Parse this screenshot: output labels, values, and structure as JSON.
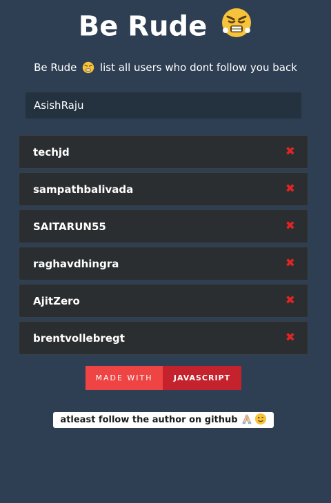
{
  "header": {
    "title": "Be Rude",
    "title_icon": "angry-face-icon"
  },
  "subtitle": {
    "before": "Be Rude",
    "icon": "angry-face-icon",
    "after": "list all users who dont follow you back"
  },
  "search": {
    "value": "AsishRaju"
  },
  "users": [
    {
      "name": "techjd"
    },
    {
      "name": "sampathbalivada"
    },
    {
      "name": "SAITARUN55"
    },
    {
      "name": "raghavdhingra"
    },
    {
      "name": "AjitZero"
    },
    {
      "name": "brentvollebregt"
    }
  ],
  "remove_icon": "cross-icon",
  "badge": {
    "left": "MADE WITH",
    "right": "JAVASCRIPT"
  },
  "footer": {
    "link_text": "atleast follow the author on github",
    "icons": [
      "folded-hands-icon",
      "winking-face-icon"
    ]
  },
  "colors": {
    "background": "#2e3f53",
    "remove": "#e02424",
    "badge_left": "#ef4444",
    "badge_right": "#c4222d"
  }
}
